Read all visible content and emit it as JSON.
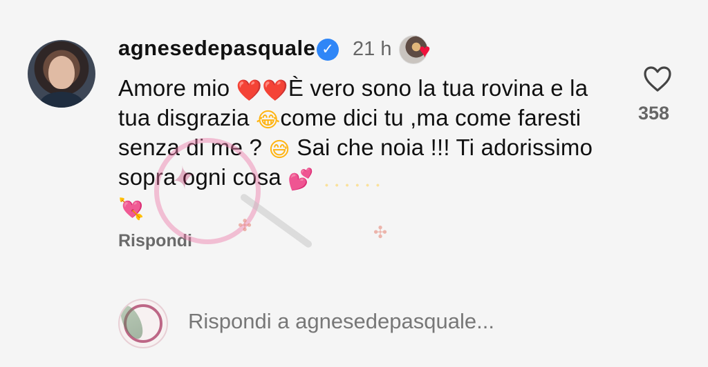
{
  "comment": {
    "username": "agnesedepasquale",
    "time": "21 h",
    "text_parts": [
      "Amore mio ",
      "❤️❤️",
      "È vero sono la tua rovina e la tua disgrazia ",
      "😂",
      "come dici tu ,ma come faresti senza di me ? ",
      "😅",
      " Sai che noia !!! Ti adorissimo sopra ogni cosa ",
      "💕",
      "💘"
    ],
    "reply_label": "Rispondi",
    "like_count": "358"
  },
  "reply_box": {
    "placeholder": "Rispondi a agnesedepasquale..."
  },
  "icons": {
    "verified": "verified-badge-icon",
    "heart": "heart-outline-icon",
    "liked_heart": "red-heart-icon"
  },
  "colors": {
    "background": "#f5f5f5",
    "verified_blue": "#2f86f7",
    "like_red": "#f0113c"
  }
}
